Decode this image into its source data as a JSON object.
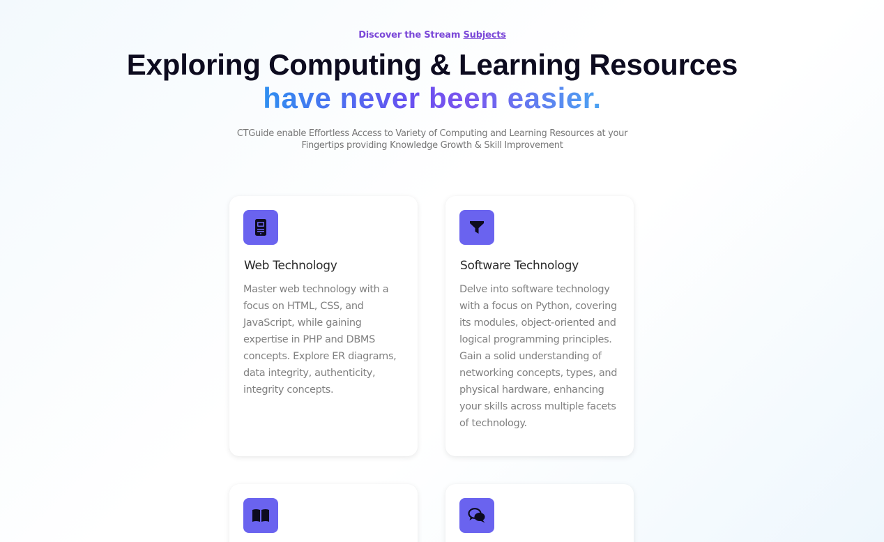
{
  "hero": {
    "eyebrow_prefix": "Discover the Stream ",
    "eyebrow_link": "Subjects",
    "title_line1": "Exploring Computing & Learning Resources",
    "title_line2": "have never been easier.",
    "subtitle": "CTGuide enable Effortless Access to Variety of Computing and Learning Resources at your Fingertips providing Knowledge Growth & Skill Improvement"
  },
  "cards": [
    {
      "icon": "mobile-device-icon",
      "title": "Web Technology",
      "description": "Master web technology with a focus on HTML, CSS, and JavaScript, while gaining expertise in PHP and DBMS concepts. Explore ER diagrams, data integrity, authenticity, integrity concepts."
    },
    {
      "icon": "funnel-icon",
      "title": "Software Technology",
      "description": "Delve into software technology with a focus on Python, covering its modules, object-oriented and logical programming principles. Gain a solid understanding of networking concepts, types, and physical hardware, enhancing your skills across multiple facets of technology."
    },
    {
      "icon": "open-book-icon",
      "title": "",
      "description": ""
    },
    {
      "icon": "chat-bubbles-icon",
      "title": "",
      "description": ""
    }
  ],
  "colors": {
    "accent_purple": "#7b48d8",
    "icon_bg": "#6a63ef",
    "gradient_blue": "#2f8ff0",
    "gradient_violet": "#6a4ef0",
    "title_dark": "#0d0b1f",
    "body_gray": "#818181"
  }
}
